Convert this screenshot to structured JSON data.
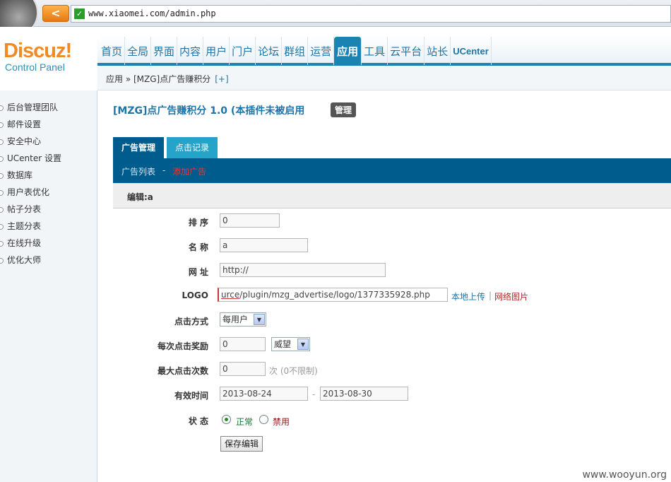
{
  "browser": {
    "back_label": "<",
    "secure_label": "✓",
    "url": "www.xiaomei.com/admin.php"
  },
  "brand": {
    "name": "Discuz!",
    "subtitle": "Control Panel"
  },
  "nav": [
    {
      "label": "首页"
    },
    {
      "label": "全局"
    },
    {
      "label": "界面"
    },
    {
      "label": "内容"
    },
    {
      "label": "用户"
    },
    {
      "label": "门户"
    },
    {
      "label": "论坛"
    },
    {
      "label": "群组"
    },
    {
      "label": "运营"
    },
    {
      "label": "应用",
      "active": true
    },
    {
      "label": "工具"
    },
    {
      "label": "云平台"
    },
    {
      "label": "站长"
    },
    {
      "label": "UCenter"
    }
  ],
  "breadcrumb": {
    "text": "应用 » [MZG]点广告赚积分",
    "add": "[+]"
  },
  "sidebar": [
    {
      "label": "后台管理团队"
    },
    {
      "label": "邮件设置"
    },
    {
      "label": "安全中心"
    },
    {
      "label": "UCenter 设置"
    },
    {
      "label": "数据库"
    },
    {
      "label": "用户表优化"
    },
    {
      "label": "帖子分表"
    },
    {
      "label": "主题分表"
    },
    {
      "label": "在线升级"
    },
    {
      "label": "优化大师"
    }
  ],
  "plugin": {
    "title": "[MZG]点广告赚积分 1.0 (本插件未被启用",
    "manage_label": "管理"
  },
  "tabs": [
    {
      "label": "广告管理",
      "active": true
    },
    {
      "label": "点击记录"
    }
  ],
  "subbar": {
    "list": "广告列表",
    "dash": "-",
    "add": "添加广告"
  },
  "edit_heading": "编辑:a",
  "form": {
    "order_label": "排 序",
    "order_value": "0",
    "name_label": "名 称",
    "name_value": "a",
    "url_label": "网 址",
    "url_value": "http://",
    "logo_label": "LOGO",
    "logo_value_prefix": "urce",
    "logo_value_rest": "/plugin/mzg_advertise/logo/1377335928.php",
    "logo_local": "本地上传",
    "logo_sep": "|",
    "logo_remote": "网络图片",
    "click_mode_label": "点击方式",
    "click_mode_value": "每用户",
    "reward_label": "每次点击奖励",
    "reward_value": "0",
    "reward_unit": "威望",
    "max_clicks_label": "最大点击次数",
    "max_clicks_value": "0",
    "max_clicks_hint": "次 (0不限制)",
    "valid_label": "有效时间",
    "valid_start": "2013-08-24",
    "valid_sep": "-",
    "valid_end": "2013-08-30",
    "status_label": "状 态",
    "status_on": "正常",
    "status_off": "禁用",
    "save_label": "保存编辑"
  },
  "watermark": "www.wooyun.org",
  "colors": {
    "brand_orange": "#f08a24",
    "nav_blue": "#1b83b2",
    "subbar_blue": "#005c8c",
    "tab_inactive": "#25a3c9"
  }
}
